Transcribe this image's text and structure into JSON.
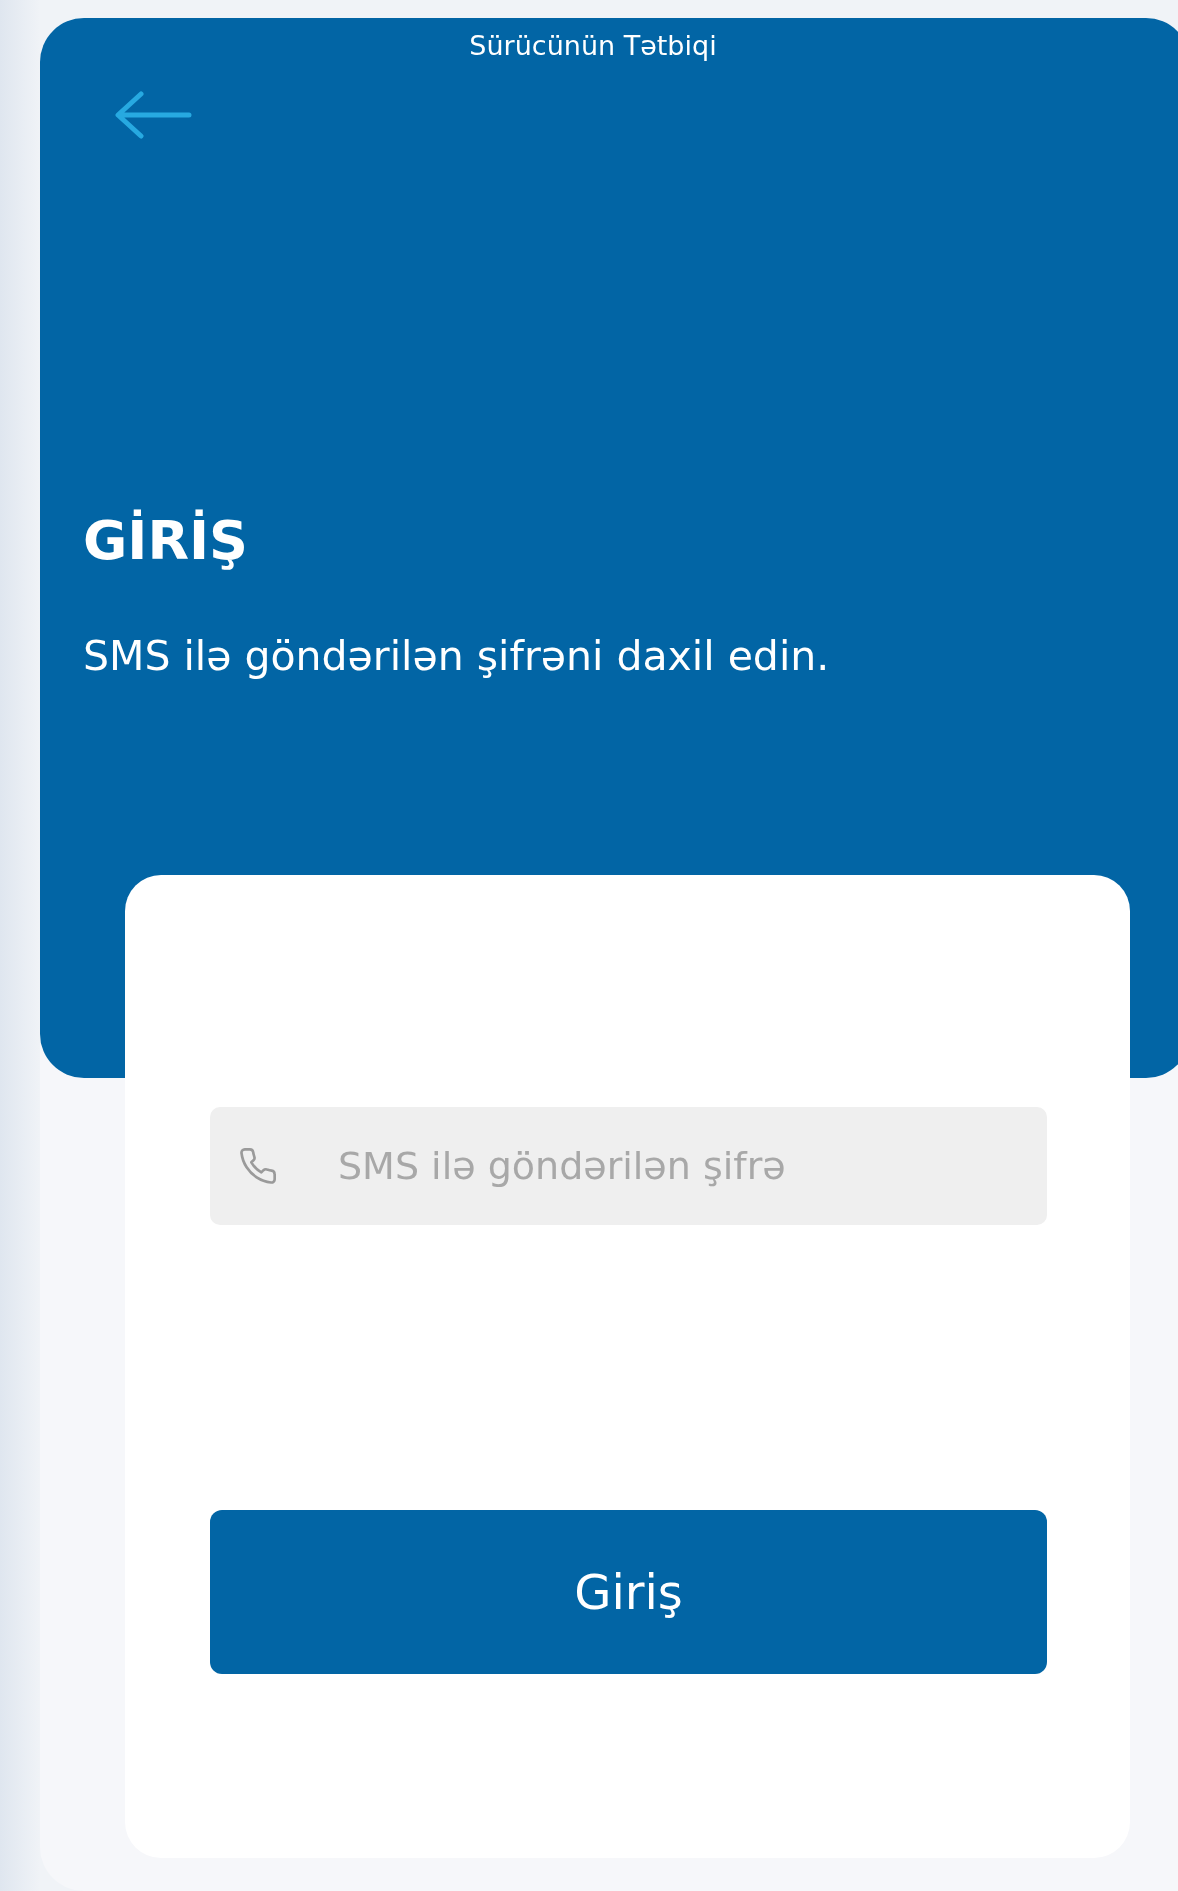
{
  "app_bar": {
    "title": "Sürücünün Tətbiqi"
  },
  "heading": "GİRİŞ",
  "subtitle": "SMS ilə göndərilən şifrəni daxil edin.",
  "code_field": {
    "placeholder": "SMS ilə göndərilən şifrə"
  },
  "login_button": "Giriş"
}
